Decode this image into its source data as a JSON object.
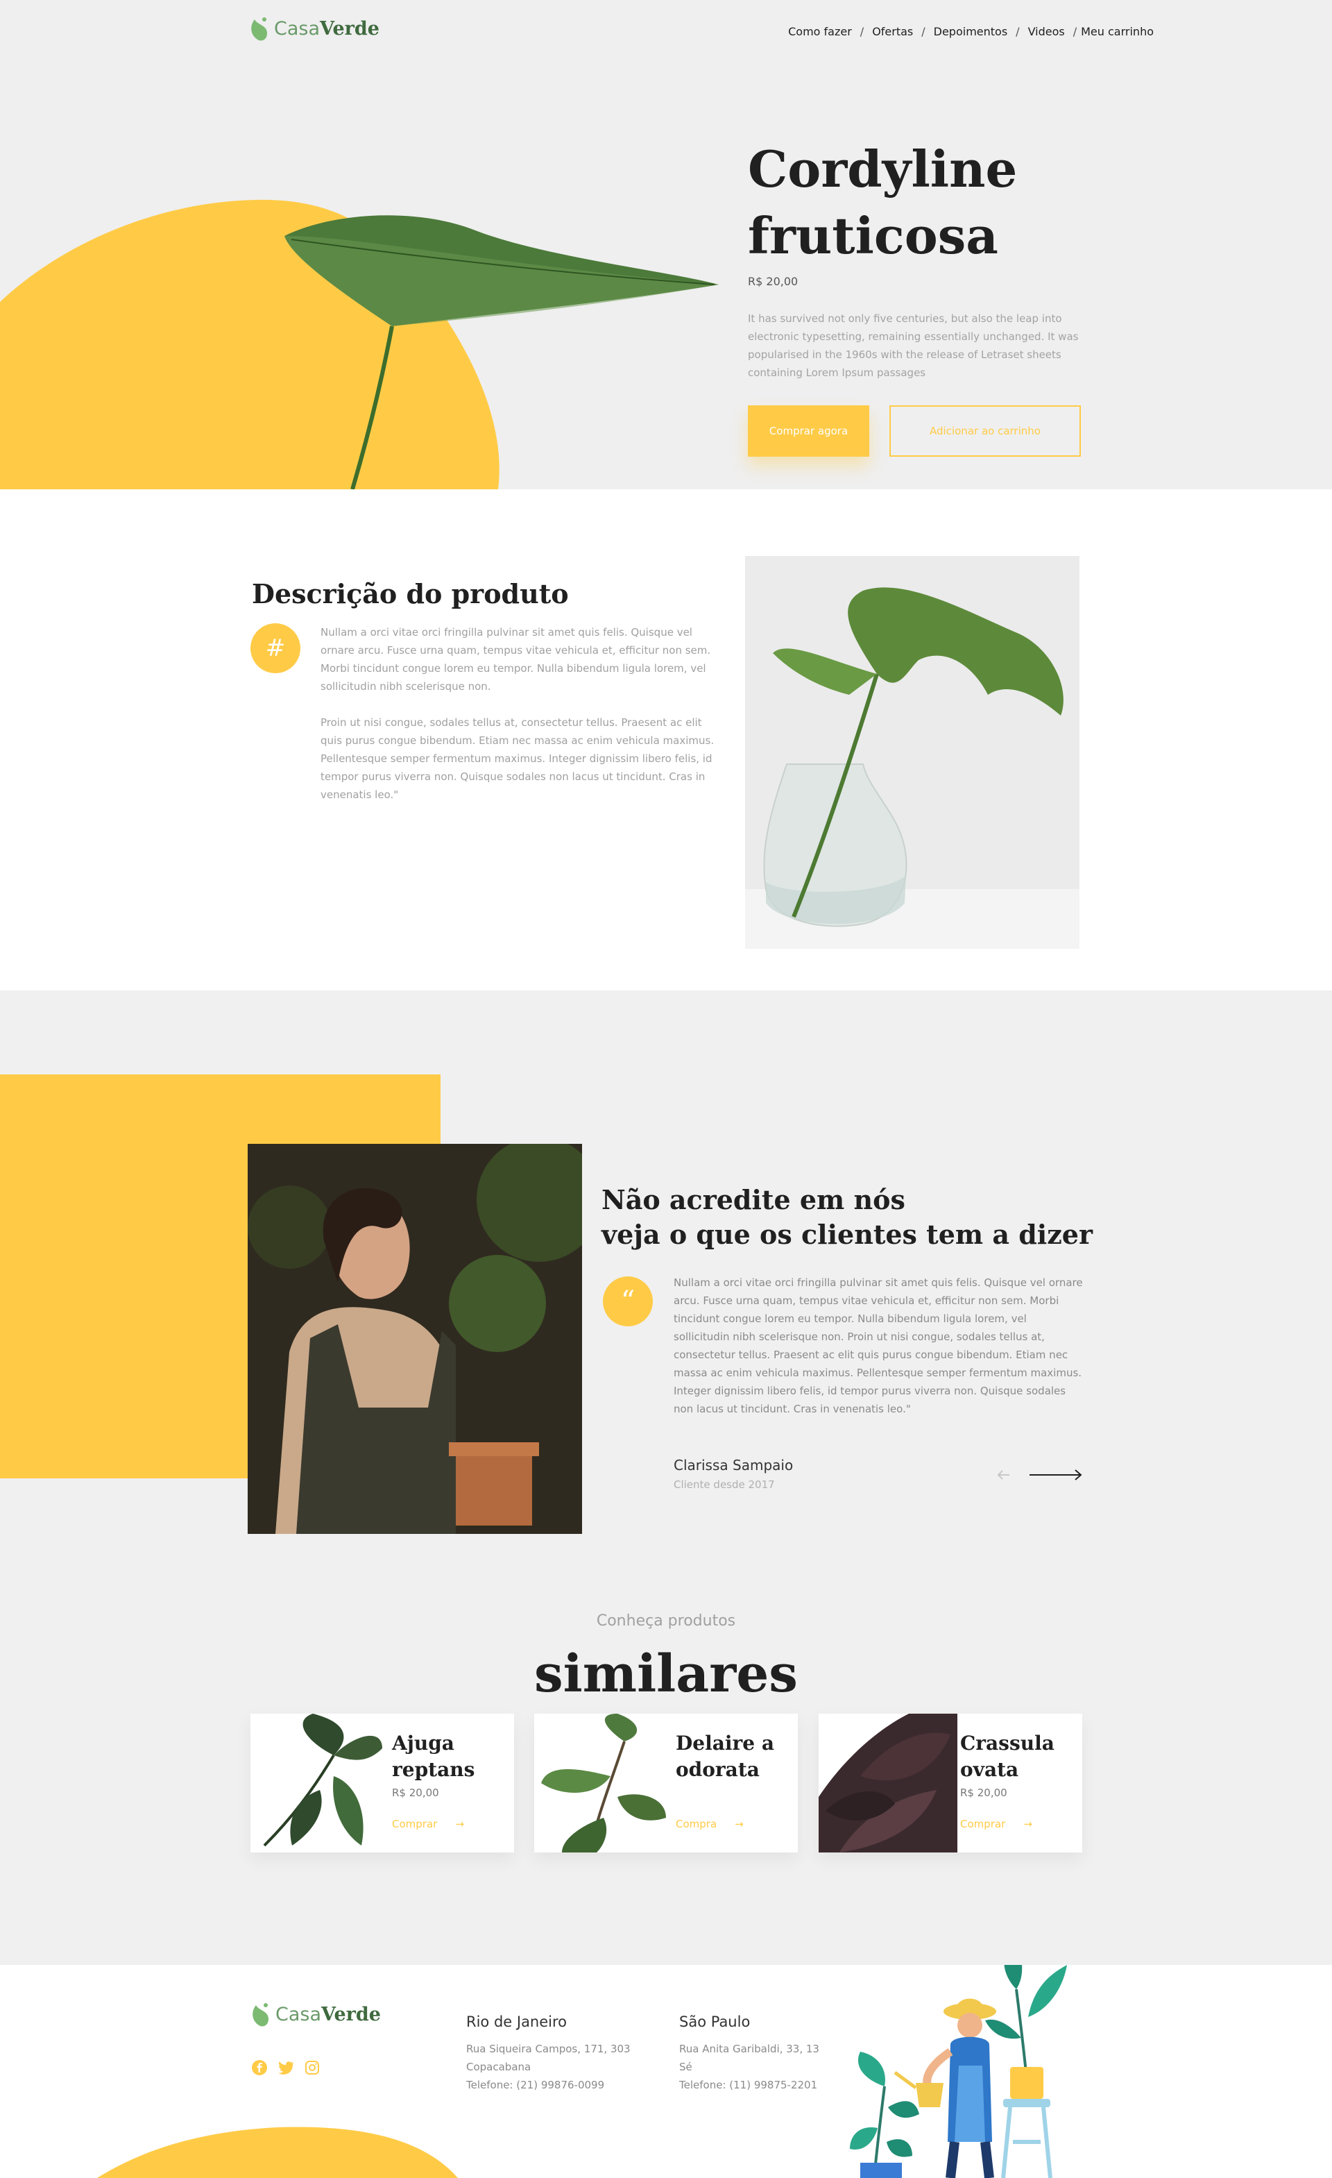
{
  "brand": {
    "name_light": "Casa",
    "name_bold": "Verde"
  },
  "nav": {
    "items": [
      "Como fazer",
      "Ofertas",
      "Depoimentos",
      "Videos",
      "Meu carrinho"
    ],
    "separator": "/"
  },
  "hero": {
    "title": "Cordyline fruticosa",
    "price": "R$ 20,00",
    "description": "It has survived not only five centuries, but also the leap into electronic typesetting, remaining essentially unchanged. It was popularised in the 1960s with the release of Letraset sheets containing Lorem Ipsum passages",
    "buy_label": "Comprar agora",
    "cart_label": "Adicionar ao carrinho"
  },
  "description": {
    "title": "Descrição do produto",
    "icon": "hashtag-icon",
    "paragraph_1": "Nullam a orci vitae orci fringilla pulvinar sit amet quis felis. Quisque vel ornare arcu. Fusce urna quam, tempus vitae vehicula et, efficitur non sem. Morbi tincidunt congue lorem eu tempor. Nulla bibendum ligula lorem, vel sollicitudin nibh scelerisque non.",
    "paragraph_2": "Proin ut nisi congue, sodales tellus at, consectetur tellus. Praesent ac elit quis purus congue bibendum. Etiam nec massa ac enim vehicula maximus. Pellentesque semper fermentum maximus. Integer dignissim libero felis, id tempor purus viverra non. Quisque sodales non lacus ut tincidunt. Cras in venenatis leo.\""
  },
  "testimonial": {
    "title_line_1": "Não acredite em nós",
    "title_line_2": "veja o que os clientes tem a dizer",
    "quote_icon": "quote-icon",
    "text": "Nullam a orci vitae orci fringilla pulvinar sit amet quis felis. Quisque vel ornare arcu. Fusce urna quam, tempus vitae vehicula et, efficitur non sem. Morbi tincidunt congue lorem eu tempor. Nulla bibendum ligula lorem, vel sollicitudin nibh scelerisque non. Proin ut nisi congue, sodales tellus at, consectetur tellus. Praesent ac elit quis purus congue bibendum. Etiam nec massa ac enim vehicula maximus. Pellentesque semper fermentum maximus. Integer dignissim libero felis, id tempor purus viverra non. Quisque sodales non lacus ut tincidunt. Cras in venenatis leo.\"",
    "author": "Clarissa Sampaio",
    "since": "Cliente desde 2017"
  },
  "similar": {
    "subtitle": "Conheça produtos",
    "title": "similares",
    "products": [
      {
        "name": "Ajuga reptans",
        "price": "R$ 20,00",
        "buy": "Comprar"
      },
      {
        "name": "Delaire a odorata",
        "price": "",
        "buy": "Compra"
      },
      {
        "name": "Crassula ovata",
        "price": "R$ 20,00",
        "buy": "Comprar"
      }
    ]
  },
  "footer": {
    "rio": {
      "title": "Rio de Janeiro",
      "address": "Rua Siqueira Campos, 171, 303 Copacabana",
      "phone": "Telefone: (21) 99876-0099"
    },
    "sp": {
      "title": "São Paulo",
      "address": "Rua Anita Garibaldi, 33, 13 Sé",
      "phone": "Telefone: (11) 99875-2201"
    },
    "social_icons": [
      "facebook-icon",
      "twitter-icon",
      "instagram-icon"
    ]
  },
  "colors": {
    "accent": "#ffcb47",
    "brand_green": "#3f6a3f",
    "text_dark": "#202020",
    "text_muted": "#a0a0a0"
  }
}
